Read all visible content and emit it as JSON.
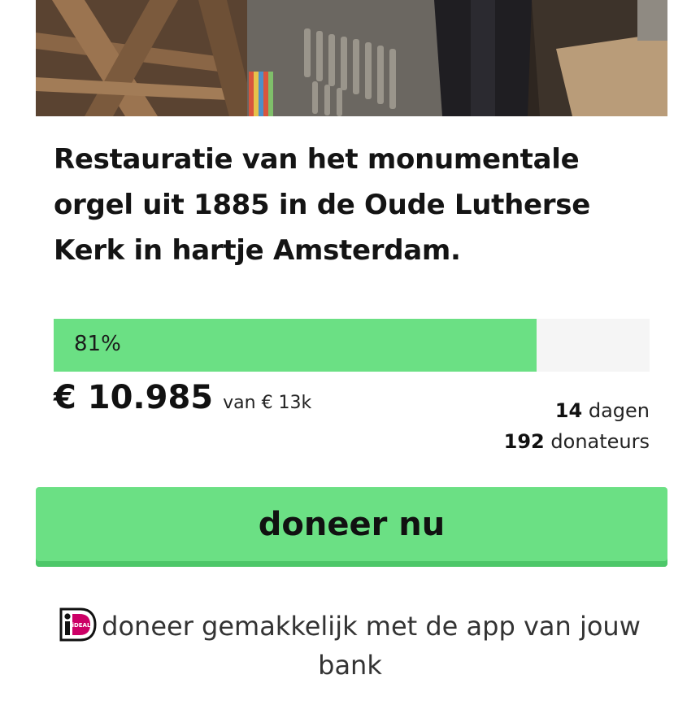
{
  "hero": {
    "image": "organ-pipes-photo"
  },
  "campaign": {
    "title": "Restauratie van het monumentale orgel uit 1885 in de Oude Lutherse Kerk in hartje Amsterdam."
  },
  "progress": {
    "percent": 81,
    "label": "81%",
    "fill_color": "#6be084",
    "raised": "€ 10.985",
    "goal": "van € 13k",
    "days_value": "14",
    "days_label": "dagen",
    "donors_value": "192",
    "donors_label": "donateurs"
  },
  "cta": {
    "donate_label": "doneer nu",
    "color": "#6be084"
  },
  "ideal": {
    "icon": "ideal-icon",
    "icon_text": "iDEAL",
    "note": "doneer gemakkelijk met de app van jouw bank"
  }
}
